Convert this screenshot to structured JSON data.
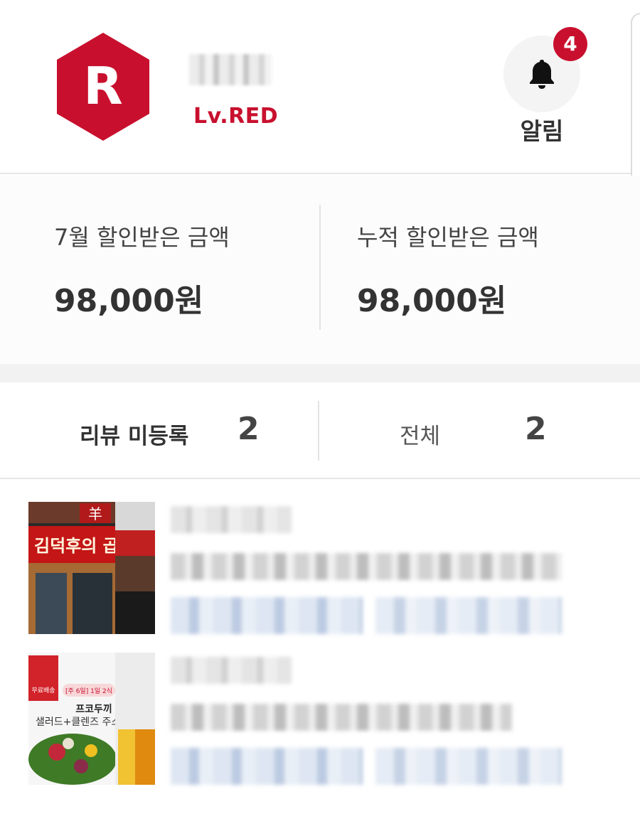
{
  "profile": {
    "grade_letter": "R",
    "level": "Lv.RED",
    "notifications": {
      "count": "4",
      "label": "알림",
      "icon": "bell-icon"
    }
  },
  "savings": {
    "monthly_label": "7월 할인받은 금액",
    "monthly_value": "98,000원",
    "total_label": "누적 할인받은 금액",
    "total_value": "98,000원"
  },
  "review_tabs": [
    {
      "label": "리뷰 미등록",
      "count": "2"
    },
    {
      "label": "전체",
      "count": "2"
    }
  ],
  "orders": [
    {
      "thumbnail_sign": "김덕후의 곱",
      "thumbnail_logo": "羊"
    },
    {
      "thumbnail_badge": "무료배송",
      "thumbnail_tag": "[주 6일] 1일 2식",
      "thumbnail_title": "프코두끼",
      "thumbnail_subtitle": "샐러드+클렌즈 주스"
    }
  ],
  "colors": {
    "brand_red": "#c8102e",
    "divider": "#e6e6e6",
    "band": "#f2f2f2"
  }
}
